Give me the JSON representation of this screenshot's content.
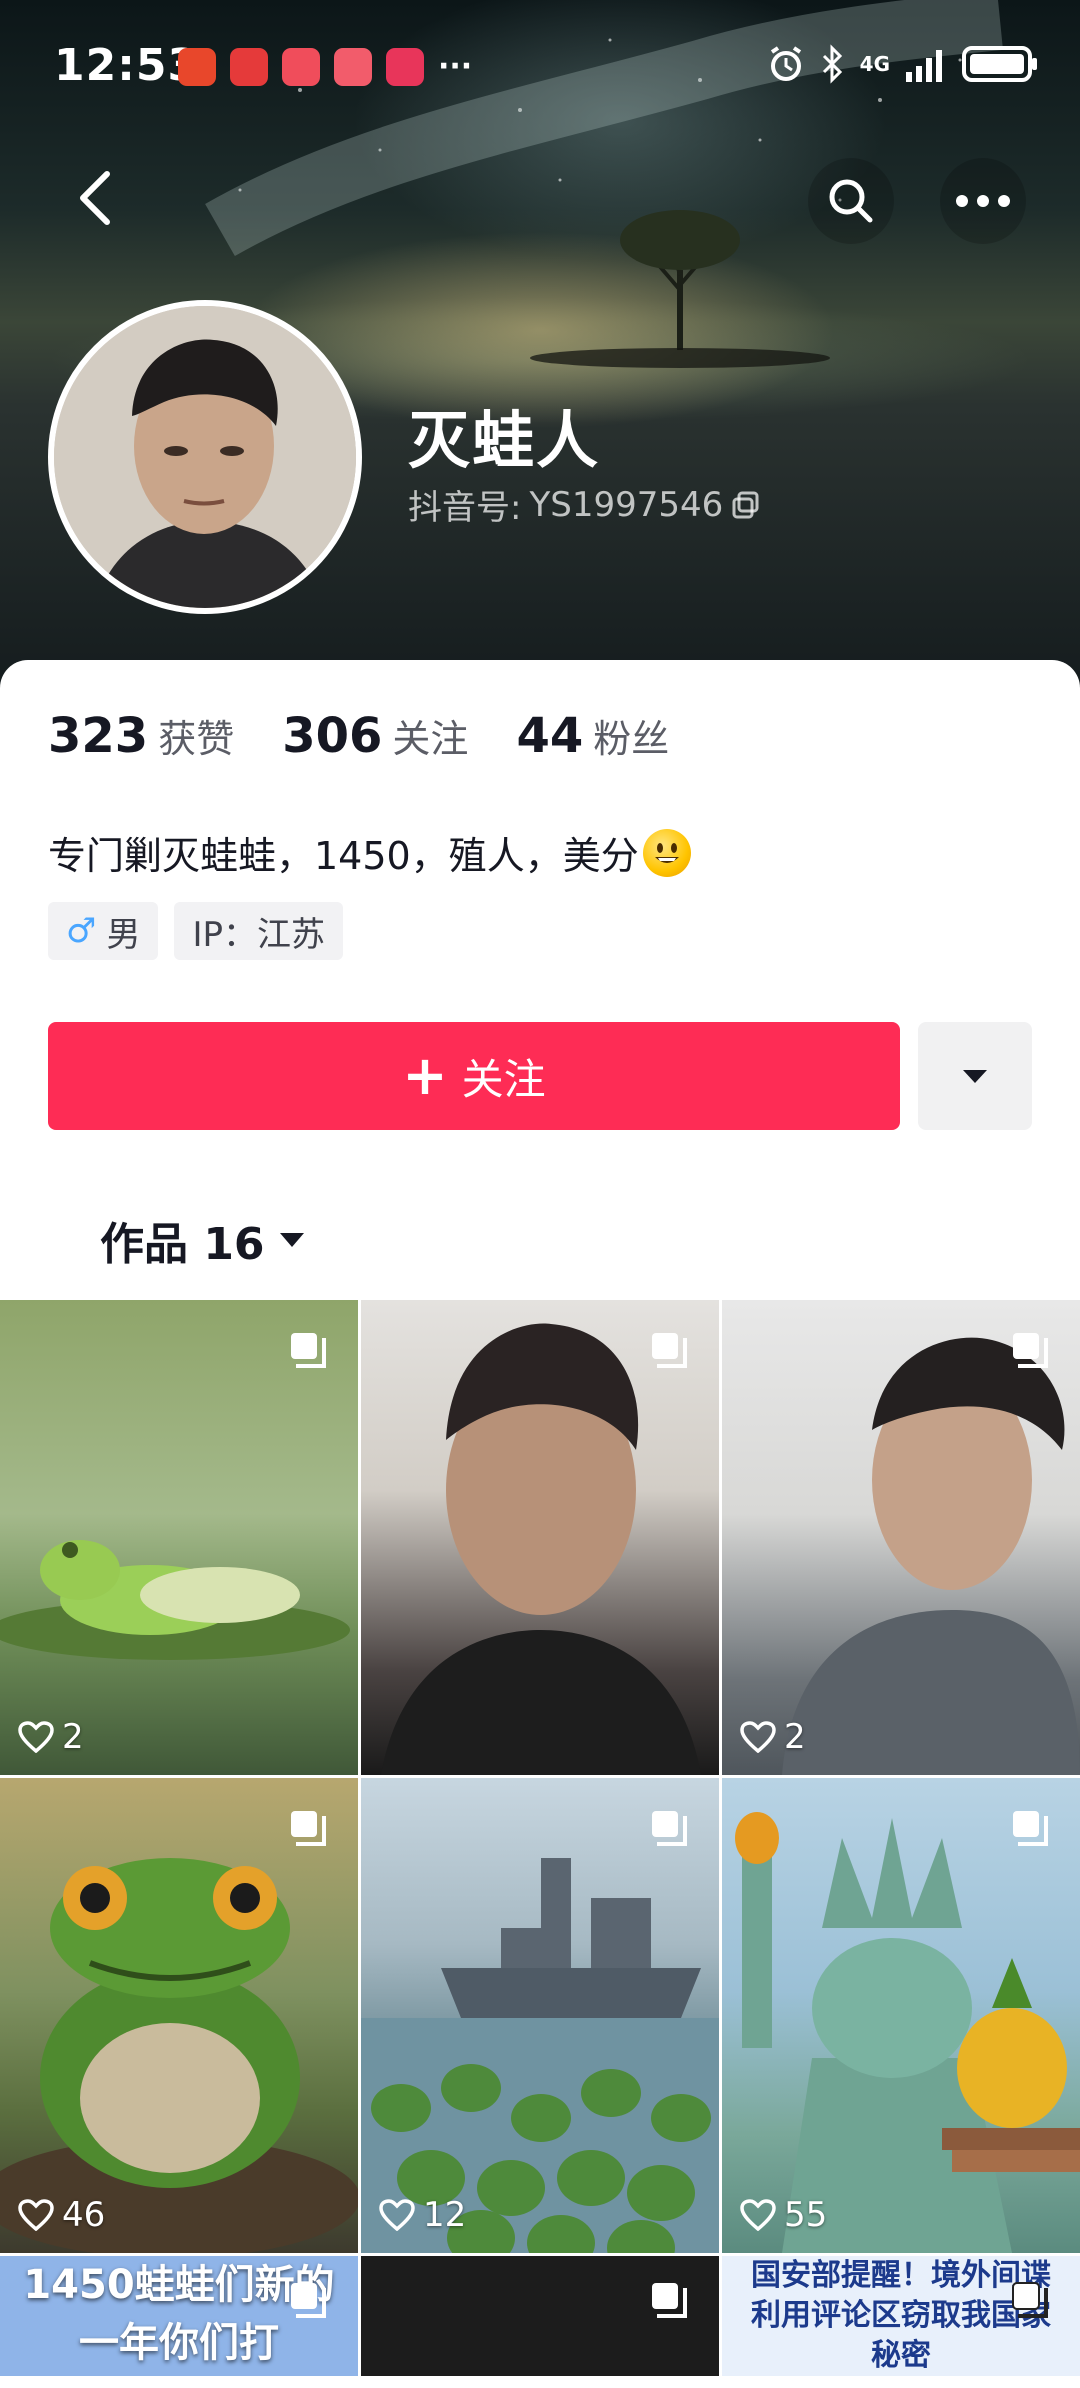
{
  "status_bar": {
    "time": "12:53",
    "network": "4G",
    "app_icons": [
      "app-icon-1",
      "app-icon-2",
      "app-icon-3",
      "app-icon-4",
      "app-icon-5"
    ]
  },
  "header": {
    "back_icon": "chevron-left-icon",
    "search_icon": "search-icon",
    "more_icon": "more-dots-icon"
  },
  "profile": {
    "nickname": "灭蛙人",
    "douyin_id_label": "抖音号:",
    "douyin_id": "YS1997546",
    "stats": [
      {
        "num": "323",
        "label": "获赞"
      },
      {
        "num": "306",
        "label": "关注"
      },
      {
        "num": "44",
        "label": "粉丝"
      }
    ],
    "bio": "专门剿灭蛙蛙，1450，殖人，美分",
    "tags": {
      "gender": "男",
      "ip": "IP：江苏"
    }
  },
  "actions": {
    "follow_label": "关注",
    "follow_plus": "+"
  },
  "works_tab": {
    "label": "作品 16"
  },
  "colors": {
    "accent": "#fe2c55",
    "gender": "#4aa6ff"
  },
  "grid": [
    {
      "likes": "2"
    },
    {
      "likes": ""
    },
    {
      "likes": "2"
    },
    {
      "likes": "46"
    },
    {
      "likes": "12"
    },
    {
      "likes": "55"
    },
    {
      "text": "1450蛙蛙们新的一年你们打"
    },
    {
      "text": ""
    },
    {
      "text": "国安部提醒！境外间谍利用评论区窃取我国家秘密"
    }
  ]
}
